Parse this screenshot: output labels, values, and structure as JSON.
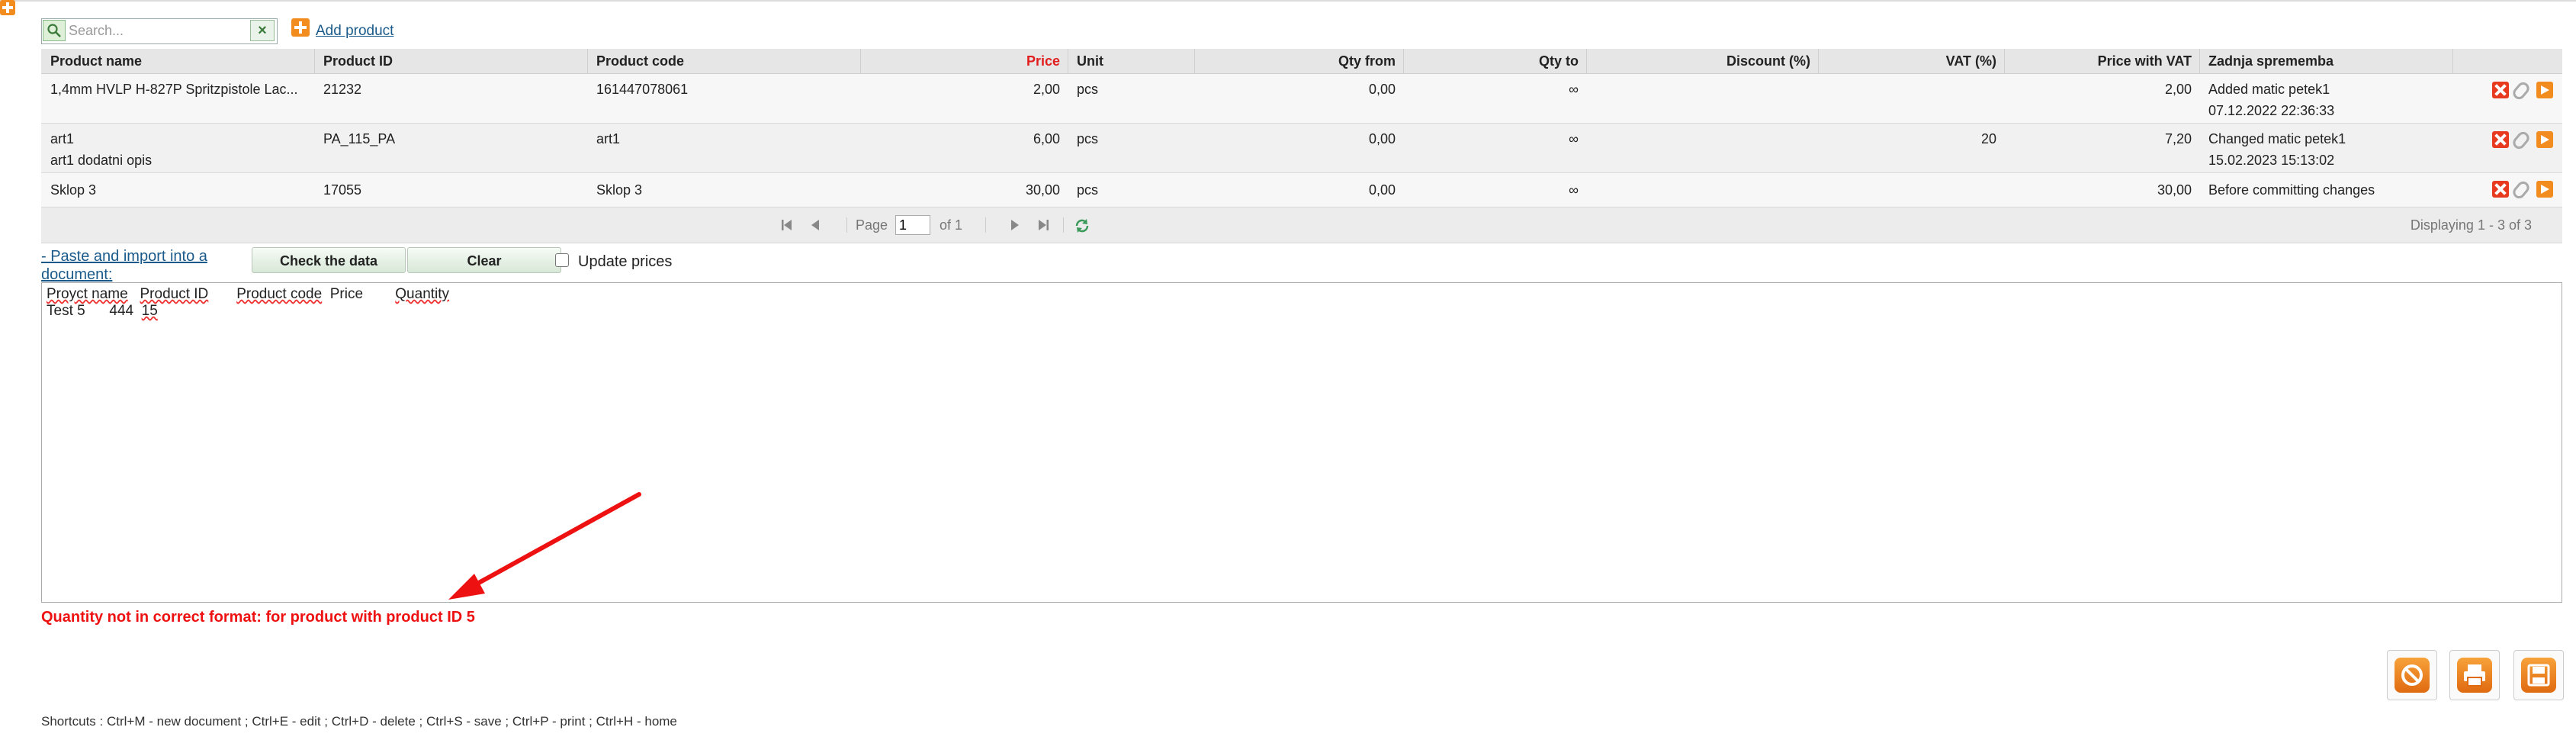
{
  "toolbar": {
    "search_placeholder": "Search...",
    "add_product_label": "Add product"
  },
  "table": {
    "headers": [
      "Product name",
      "Product ID",
      "Product code",
      "Price",
      "Unit",
      "Qty from",
      "Qty to",
      "Discount (%)",
      "VAT (%)",
      "Price with VAT",
      "Zadnja sprememba"
    ],
    "price_header_color": "#e11d1d",
    "rows": [
      {
        "name": "1,4mm HVLP H-827P Spritzpistole Lac...",
        "name2": "",
        "product_id": "21232",
        "product_code": "161447078061",
        "price": "2,00",
        "unit": "pcs",
        "qty_from": "0,00",
        "qty_to": "∞",
        "discount": "",
        "vat": "",
        "price_vat": "2,00",
        "change1": "Added matic petek1",
        "change2": "07.12.2022 22:36:33"
      },
      {
        "name": "art1",
        "name2": "art1 dodatni opis",
        "product_id": "PA_115_PA",
        "product_code": "art1",
        "price": "6,00",
        "unit": "pcs",
        "qty_from": "0,00",
        "qty_to": "∞",
        "discount": "",
        "vat": "20",
        "price_vat": "7,20",
        "change1": "Changed matic petek1",
        "change2": "15.02.2023 15:13:02"
      },
      {
        "name": "Sklop 3",
        "name2": "",
        "product_id": "17055",
        "product_code": "Sklop 3",
        "price": "30,00",
        "unit": "pcs",
        "qty_from": "0,00",
        "qty_to": "∞",
        "discount": "",
        "vat": "",
        "price_vat": "30,00",
        "change1": "Before committing changes",
        "change2": ""
      }
    ]
  },
  "pager": {
    "page_label": "Page",
    "page_value": "1",
    "of_label": "of 1",
    "displaying": "Displaying 1 - 3 of 3"
  },
  "paste": {
    "link_label": "- Paste and import into a document:",
    "check_label": "Check the data",
    "clear_label": "Clear",
    "update_prices_label": "Update prices",
    "update_prices_checked": false,
    "header_line": [
      "Proуct name",
      "Product ID",
      "Product code",
      "Price",
      "Quantity"
    ],
    "data_line": [
      "Test 5",
      "444",
      "15"
    ]
  },
  "error_message": "Quantity not in correct format: for product with product ID 5",
  "shortcuts": "Shortcuts : Ctrl+M - new document ;   Ctrl+E - edit ;   Ctrl+D - delete ;   Ctrl+S - save ;   Ctrl+P - print ;   Ctrl+H - home",
  "icons": {
    "corner": "add-icon",
    "search": "search-icon",
    "clear_search": "clear-icon",
    "row_actions": [
      "delete-icon",
      "attach-icon",
      "open-icon"
    ],
    "bottom": [
      "cancel-icon",
      "print-icon",
      "save-icon"
    ],
    "accent": "#f28c1e"
  }
}
